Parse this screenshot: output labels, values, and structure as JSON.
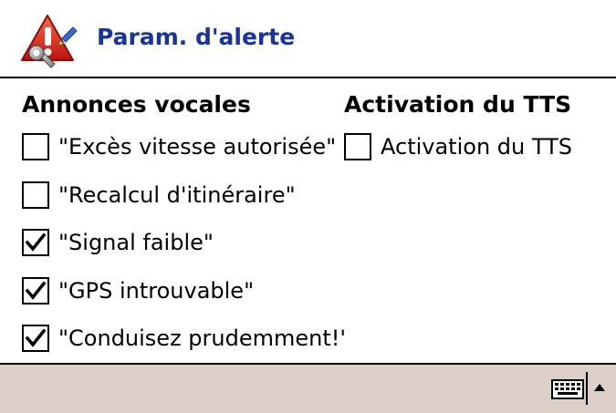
{
  "header": {
    "title": "Param. d'alerte",
    "icon": "alert-settings-icon"
  },
  "left_column": {
    "heading": "Annonces vocales",
    "items": [
      {
        "label": "\"Excès vitesse autorisée\"",
        "checked": false
      },
      {
        "label": "\"Recalcul d'itinéraire\"",
        "checked": false
      },
      {
        "label": "\"Signal faible\"",
        "checked": true
      },
      {
        "label": "\"GPS introuvable\"",
        "checked": true
      },
      {
        "label": "\"Conduisez prudemment!'",
        "checked": true
      }
    ]
  },
  "right_column": {
    "heading": "Activation du TTS",
    "items": [
      {
        "label": "Activation du TTS",
        "checked": false
      }
    ]
  },
  "taskbar": {
    "keyboard_icon": "keyboard-icon",
    "arrow_icon": "up-arrow-icon"
  },
  "colors": {
    "title": "#1a3399",
    "taskbar": "#dcd0c8",
    "icon_red": "#d8261e"
  }
}
